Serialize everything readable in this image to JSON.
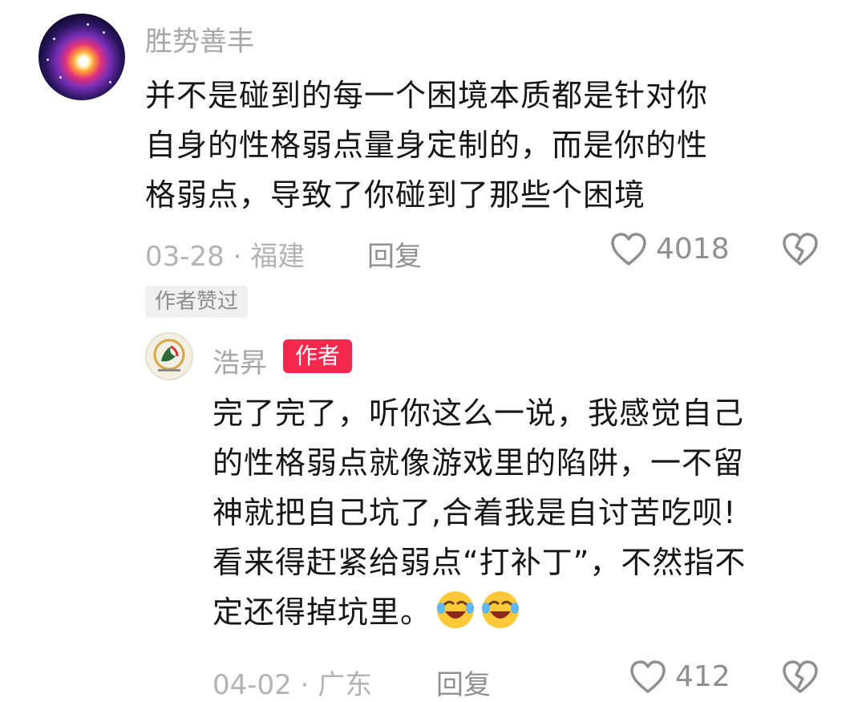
{
  "comment": {
    "author": "胜势善丰",
    "lines": [
      "并不是碰到的每一个困境本质都是针对你",
      "自身的性格弱点量身定制的，而是你的性",
      "格弱点，导致了你碰到了那些个困境"
    ],
    "date_location": "03-28 · 福建",
    "reply_label": "回复",
    "like_count": "4018",
    "author_liked_tag": "作者赞过",
    "icons": [
      "avatar-galaxy",
      "heart-outline-icon",
      "broken-heart-icon"
    ]
  },
  "reply": {
    "author": "浩昇",
    "author_badge": "作者",
    "lines": [
      "完了完了，听你这么一说，我感觉自己",
      "的性格弱点就像游戏里的陷阱，一不留",
      "神就把自己坑了,合着我是自讨苦吃呗!",
      "看来得赶紧给弱点“打补丁”，不然指不",
      "定还得掉坑里。"
    ],
    "date_location": "04-02 · 广东",
    "reply_label": "回复",
    "like_count": "412",
    "icons": [
      "avatar-emblem",
      "laughing-crying-emoji",
      "heart-outline-icon",
      "broken-heart-icon"
    ],
    "badge_color": "#f5294e"
  }
}
